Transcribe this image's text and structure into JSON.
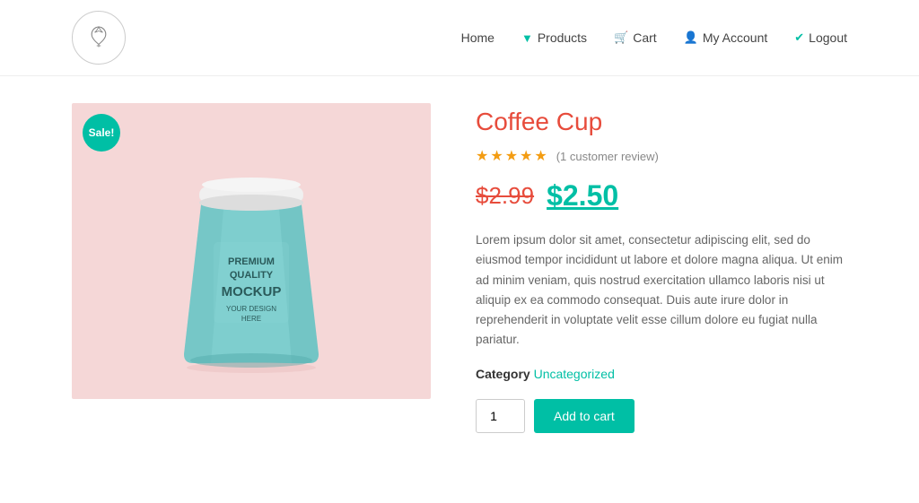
{
  "header": {
    "logo_alt": "Bird Logo",
    "nav": {
      "home": "Home",
      "products": "Products",
      "cart": "Cart",
      "my_account": "My Account",
      "logout": "Logout"
    }
  },
  "product": {
    "sale_badge": "Sale!",
    "title": "Coffee Cup",
    "stars": "★★★★★",
    "review_count": "(1 customer review)",
    "price_old": "$2.99",
    "price_new": "$2.50",
    "description": "Lorem ipsum dolor sit amet, consectetur adipiscing elit, sed do eiusmod tempor incididunt ut labore et dolore magna aliqua. Ut enim ad minim veniam, quis nostrud exercitation ullamco laboris nisi ut aliquip ex ea commodo consequat. Duis aute irure dolor in reprehenderit in voluptate velit esse cillum dolore eu fugiat nulla pariatur.",
    "category_label": "Category",
    "category_value": "Uncategorized",
    "quantity_default": "1",
    "add_to_cart_label": "Add to cart"
  },
  "icons": {
    "cart": "🛒",
    "user": "👤",
    "check": "✔",
    "chevron_down": "▼"
  }
}
